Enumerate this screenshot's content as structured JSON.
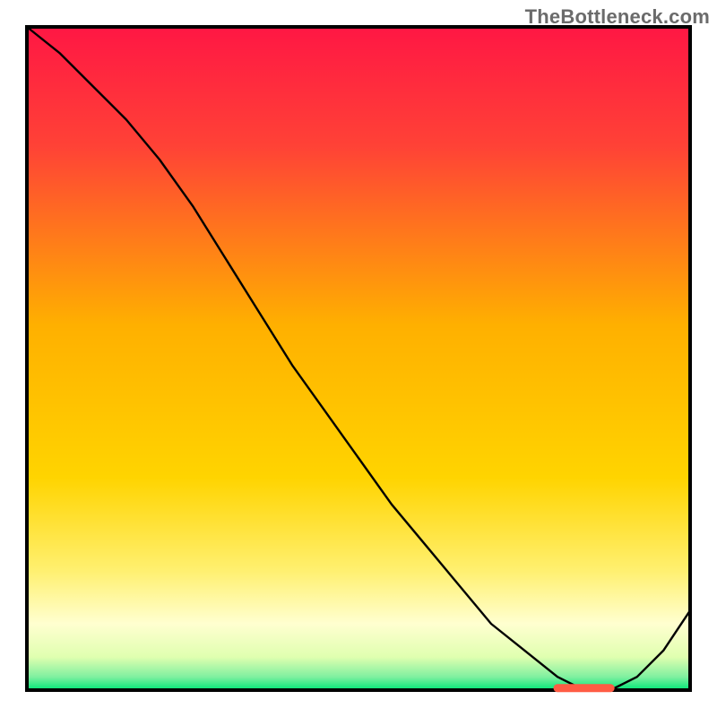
{
  "watermark": "TheBottleneck.com",
  "chart_data": {
    "type": "line",
    "title": "",
    "xlabel": "",
    "ylabel": "",
    "xlim": [
      0,
      100
    ],
    "ylim": [
      0,
      100
    ],
    "grid": false,
    "legend": false,
    "background_gradient": {
      "top_color": "#ff1744",
      "mid_color": "#ffd400",
      "bottom_color": "#00e676",
      "pale_band_color": "#ffffcc"
    },
    "series": [
      {
        "name": "curve",
        "color": "#000000",
        "width": 2,
        "x": [
          0,
          5,
          10,
          15,
          20,
          25,
          30,
          35,
          40,
          45,
          50,
          55,
          60,
          65,
          70,
          75,
          80,
          84,
          88,
          92,
          96,
          100
        ],
        "y": [
          100,
          96,
          91,
          86,
          80,
          73,
          65,
          57,
          49,
          42,
          35,
          28,
          22,
          16,
          10,
          6,
          2,
          0,
          0,
          2,
          6,
          12
        ]
      }
    ],
    "annotations": [
      {
        "name": "highlight-segment",
        "type": "thick-line",
        "color": "#ff5c44",
        "width": 9,
        "x0": 80,
        "x1": 88,
        "y": 0.3
      }
    ]
  }
}
